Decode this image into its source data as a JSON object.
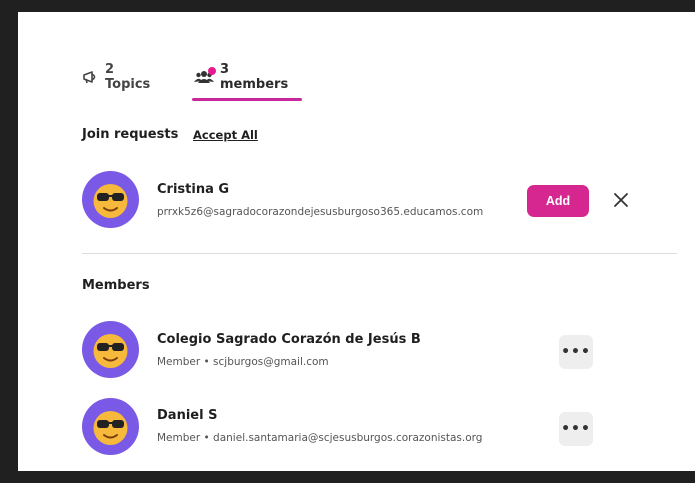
{
  "colors": {
    "accent": "#d6268f",
    "avatar_bg": "#7a59e6"
  },
  "tabs": {
    "topics_label": "2 Topics",
    "members_label": "3 members",
    "topics_icon": "megaphone-icon",
    "members_icon": "people-icon"
  },
  "join_requests": {
    "title": "Join requests",
    "accept_all_label": "Accept All",
    "items": [
      {
        "name": "Cristina G",
        "email": "prrxk5z6@sagradocorazondejesusburgoso365.educamos.com",
        "add_label": "Add"
      }
    ]
  },
  "members": {
    "title": "Members",
    "items": [
      {
        "name": "Colegio Sagrado Corazón de Jesús B",
        "detail": "Member • scjburgos@gmail.com",
        "more_label": "•••"
      },
      {
        "name": "Daniel S",
        "detail": "Member • daniel.santamaria@scjesusburgos.corazonistas.org",
        "more_label": "•••"
      }
    ]
  }
}
